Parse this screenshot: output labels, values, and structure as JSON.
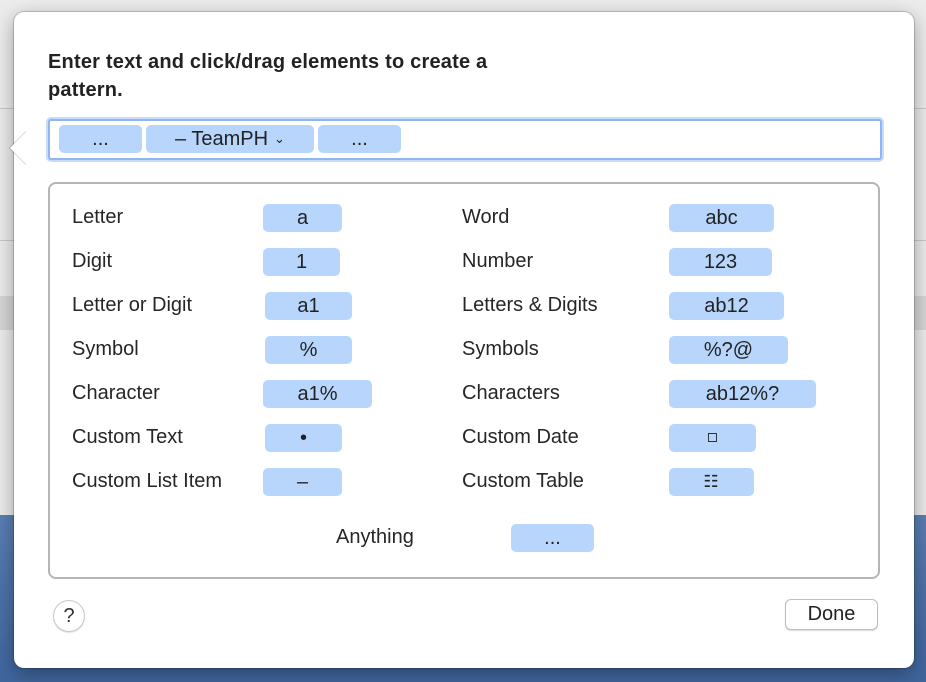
{
  "dialog": {
    "title": "Enter text and click/drag elements to create a pattern."
  },
  "pattern": {
    "tokens": [
      {
        "label": "..."
      },
      {
        "label": "– TeamPH",
        "dropdown": true
      },
      {
        "label": "..."
      }
    ]
  },
  "elements": {
    "left": [
      {
        "label": "Letter",
        "chip": "a"
      },
      {
        "label": "Digit",
        "chip": "1"
      },
      {
        "label": "Letter or Digit",
        "chip": "a1"
      },
      {
        "label": "Symbol",
        "chip": "%"
      },
      {
        "label": "Character",
        "chip": "a1%"
      },
      {
        "label": "Custom Text",
        "chip": "•"
      },
      {
        "label": "Custom List Item",
        "chip": "–"
      }
    ],
    "right": [
      {
        "label": "Word",
        "chip": "abc"
      },
      {
        "label": "Number",
        "chip": "123"
      },
      {
        "label": "Letters & Digits",
        "chip": "ab12"
      },
      {
        "label": "Symbols",
        "chip": "%?@"
      },
      {
        "label": "Characters",
        "chip": "ab12%?"
      },
      {
        "label": "Custom Date",
        "chip_icon": "small-square-icon"
      },
      {
        "label": "Custom Table",
        "chip": "☷"
      }
    ],
    "anything": {
      "label": "Anything",
      "chip": "..."
    }
  },
  "buttons": {
    "help": "?",
    "done": "Done"
  },
  "colors": {
    "chip_fill": "#b8d6fb",
    "focus_ring": "#8fb6f0"
  }
}
